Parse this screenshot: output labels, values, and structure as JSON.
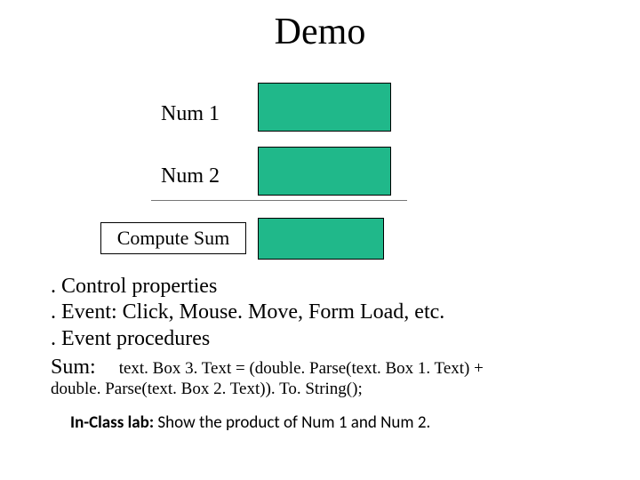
{
  "title": "Demo",
  "labels": {
    "num1": "Num 1",
    "num2": "Num 2"
  },
  "button": {
    "compute": "Compute Sum"
  },
  "bullets": {
    "b1": ". Control properties",
    "b2": ". Event: Click, Mouse. Move, Form Load, etc.",
    "b3": ". Event procedures"
  },
  "sum": {
    "label": "Sum:",
    "code1": "text. Box 3. Text = (double. Parse(text. Box 1. Text) +",
    "code2": "double. Parse(text. Box 2. Text)). To. String();"
  },
  "footer": {
    "bold": "In-Class lab: ",
    "rest": "Show the product of Num 1 and Num 2."
  }
}
